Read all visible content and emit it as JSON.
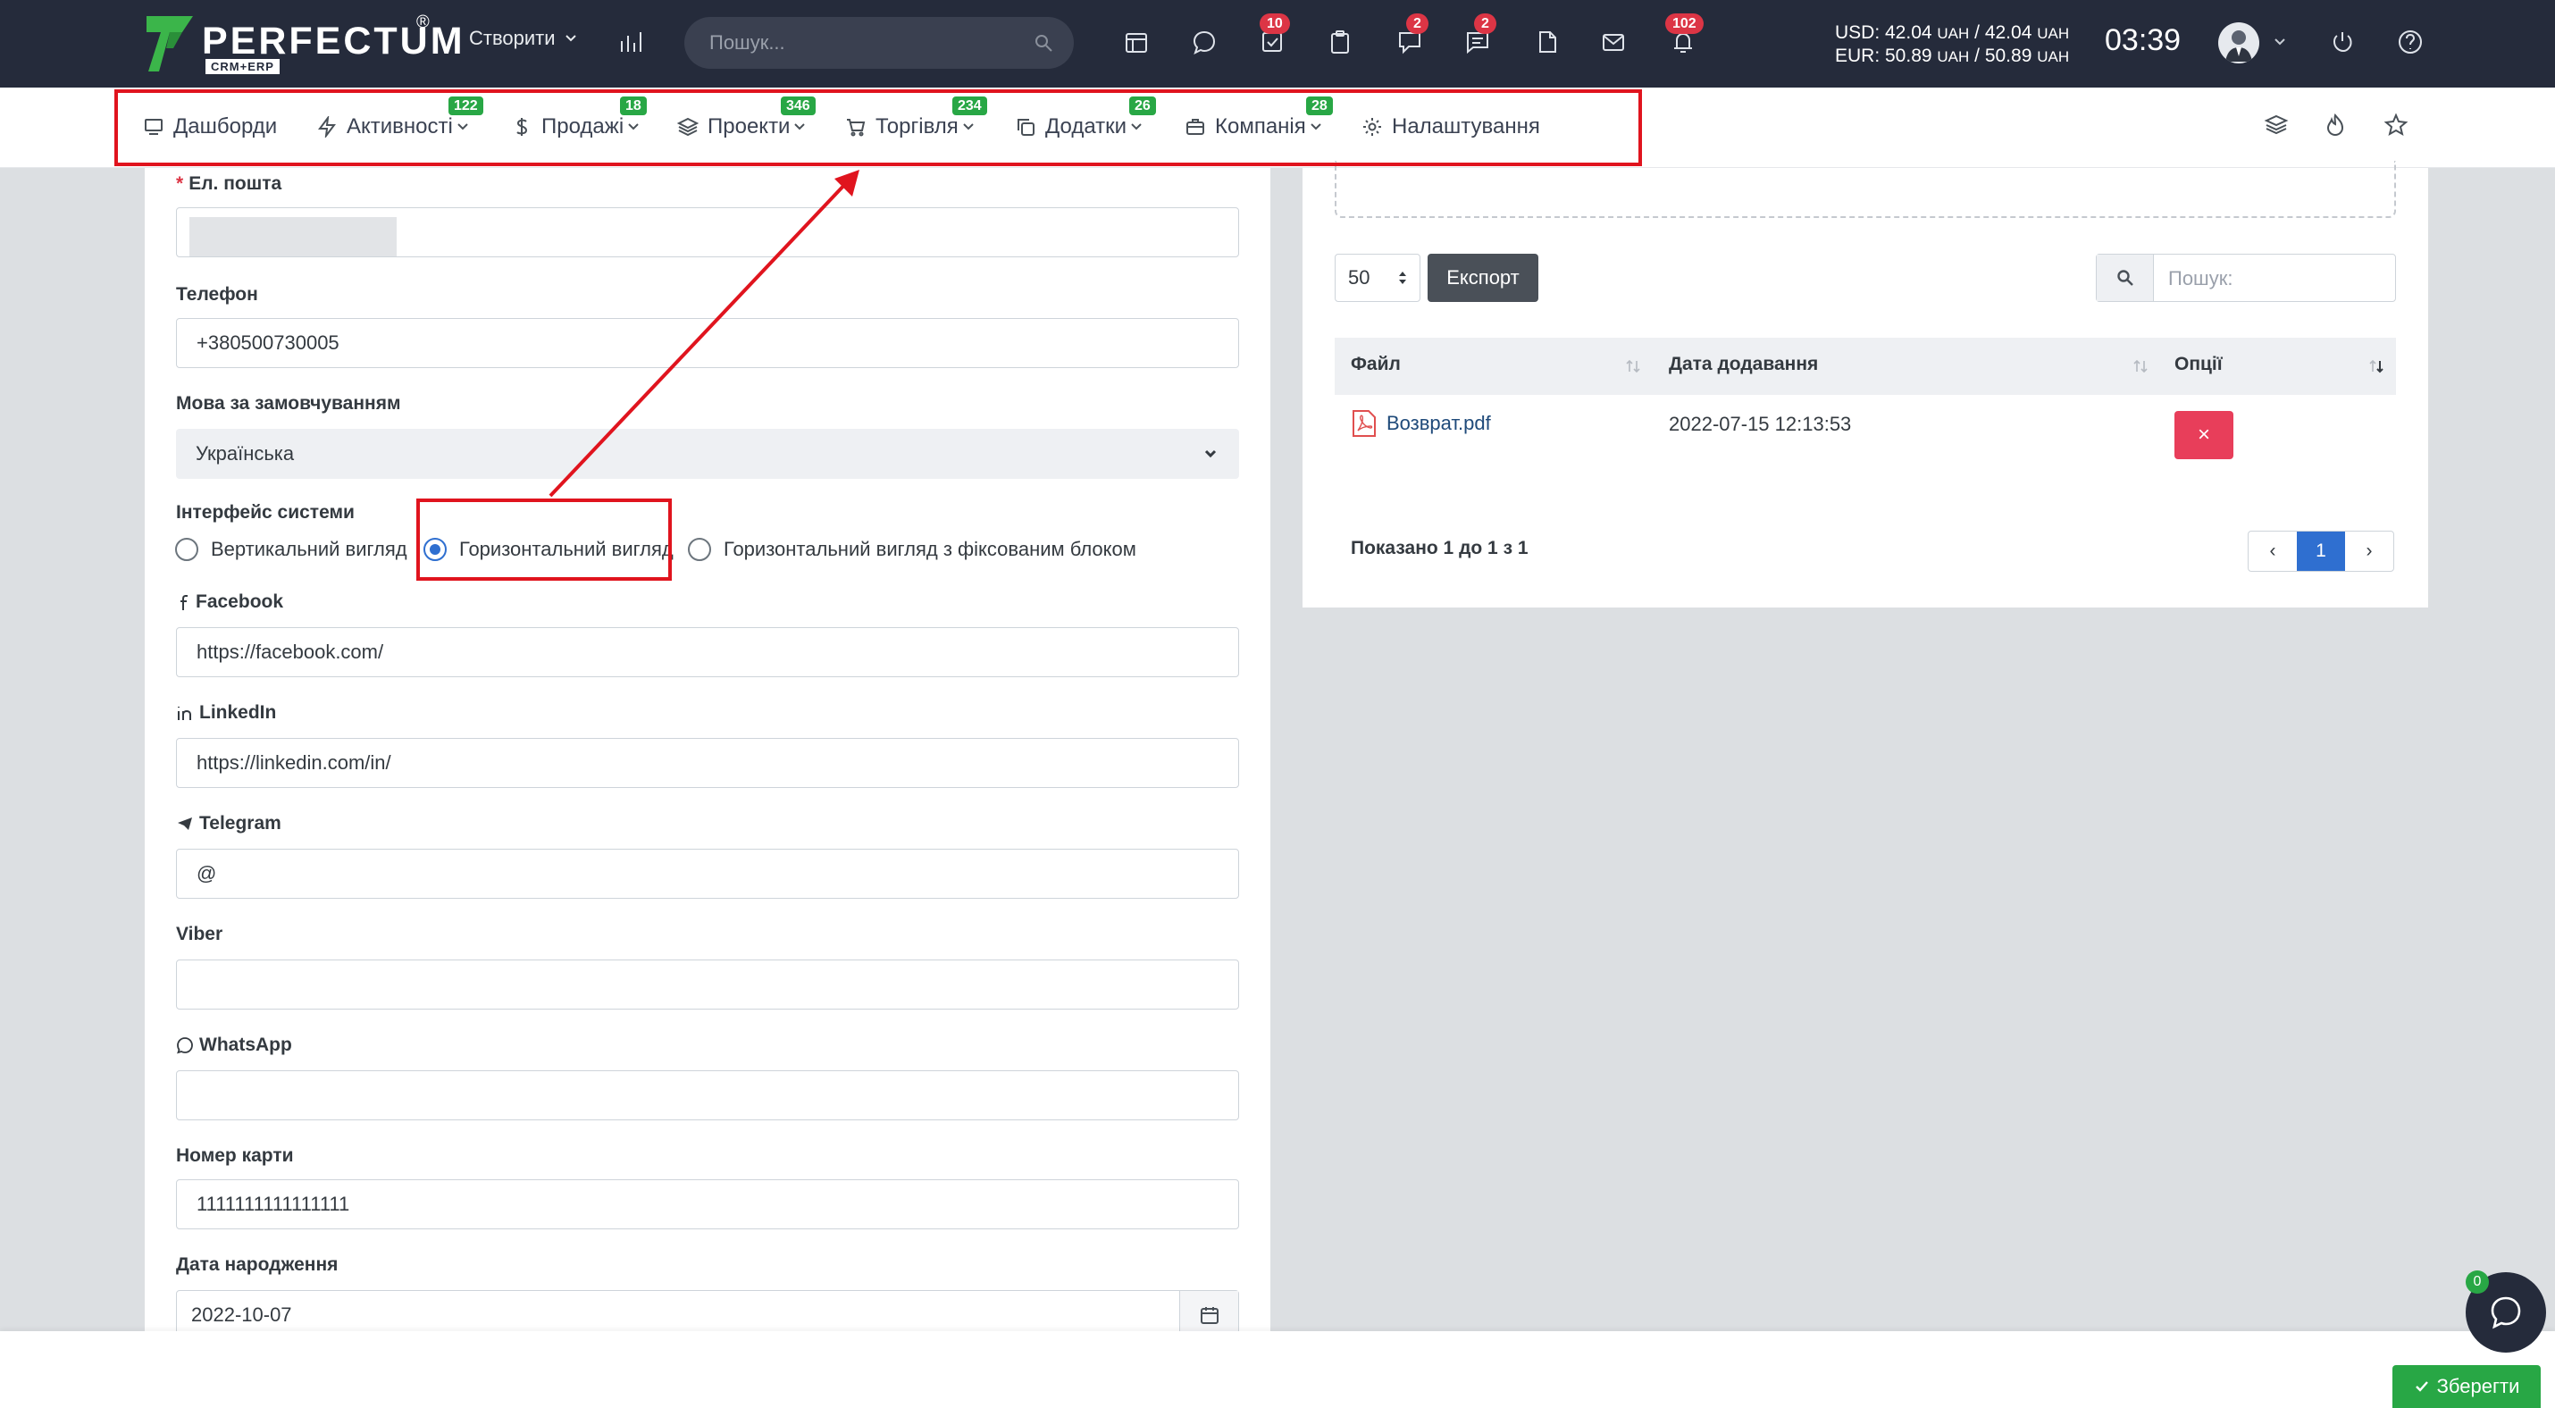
{
  "topbar": {
    "brand": "PERFECTUM",
    "brand_reg": "®",
    "brand_sub": "CRM+ERP",
    "create_label": "Створити",
    "search_placeholder": "Пошук...",
    "badges": {
      "tasks": "10",
      "chat": "2",
      "comments": "2",
      "notifications": "102"
    },
    "currency_usd": "USD: 42.04",
    "currency_usd_b": "/ 42.04",
    "currency_eur": "EUR: 50.89",
    "currency_eur_b": "/ 50.89",
    "currency_unit": "UAH",
    "clock": "03:39",
    "icons": [
      "chart-icon",
      "calendar-icon",
      "chat-icon",
      "check-icon",
      "clipboard-icon",
      "comment-icon",
      "message-icon",
      "file-icon",
      "mail-icon",
      "bell-icon",
      "power-icon",
      "help-icon"
    ]
  },
  "nav": {
    "items": [
      {
        "label": "Дашборди",
        "badge": ""
      },
      {
        "label": "Активності",
        "badge": "122"
      },
      {
        "label": "Продажі",
        "badge": "18"
      },
      {
        "label": "Проекти",
        "badge": "346"
      },
      {
        "label": "Торгівля",
        "badge": "234"
      },
      {
        "label": "Додатки",
        "badge": "26"
      },
      {
        "label": "Компанія",
        "badge": "28"
      },
      {
        "label": "Налаштування",
        "badge": ""
      }
    ]
  },
  "form": {
    "email_label": "Ел. пошта",
    "email_required_mark": "*",
    "phone_label": "Телефон",
    "phone_value": "+380500730005",
    "language_label": "Мова за замовчуванням",
    "language_value": "Українська",
    "interface_label": "Інтерфейс системи",
    "interface_options": [
      "Вертикальний вигляд",
      "Горизонтальний вигляд",
      "Горизонтальний вигляд з фіксованим блоком"
    ],
    "interface_selected": "Горизонтальний вигляд",
    "facebook_label": "Facebook",
    "facebook_value": "https://facebook.com/",
    "linkedin_label": "LinkedIn",
    "linkedin_value": "https://linkedin.com/in/",
    "telegram_label": "Telegram",
    "telegram_value": "@",
    "viber_label": "Viber",
    "viber_value": "",
    "whatsapp_label": "WhatsApp",
    "whatsapp_value": "",
    "card_label": "Номер карти",
    "card_value": "1111111111111111",
    "birth_label": "Дата народження",
    "birth_value": "2022-10-07"
  },
  "files": {
    "page_length": "50",
    "export_label": "Експорт",
    "search_placeholder": "Пошук:",
    "columns": [
      "Файл",
      "Дата додавання",
      "Опції"
    ],
    "rows": [
      {
        "file": "Возврат.pdf",
        "date": "2022-07-15 12:13:53"
      }
    ],
    "delete_label": "×",
    "showing": "Показано 1 до 1 з 1",
    "pages": [
      "‹",
      "1",
      "›"
    ]
  },
  "footer": {
    "save_label": "Зберегти",
    "chat_badge": "0"
  },
  "colors": {
    "topbar": "#252b3b",
    "badge_red": "#dc3545",
    "badge_green": "#28a745",
    "annotation": "#e0141e",
    "primary": "#2f6fd0",
    "danger": "#e83e5a"
  }
}
